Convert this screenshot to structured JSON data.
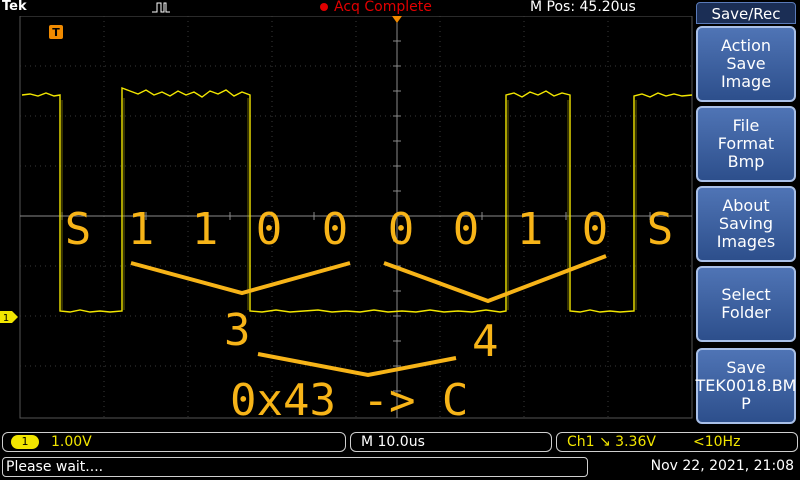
{
  "topbar": {
    "brand": "Tek",
    "acq_status": "Acq Complete",
    "mpos": "M Pos: 45.20us"
  },
  "menu": {
    "title": "Save/Rec",
    "buttons": [
      {
        "label": "Action\nSave Image"
      },
      {
        "label": "File\nFormat\nBmp"
      },
      {
        "label": "About\nSaving\nImages"
      },
      {
        "label": "Select\nFolder"
      },
      {
        "label": "Save\nTEK0018.BM\nP"
      }
    ]
  },
  "channel": {
    "badge": "1",
    "scale": "1.00V",
    "marker": "1",
    "color": "#f2e600"
  },
  "timebase": {
    "scale": "M 10.0us"
  },
  "trigger": {
    "source_level": "Ch1 ↘ 3.36V",
    "freq": "<10Hz",
    "marker": "T"
  },
  "status": {
    "message": "Please wait....",
    "datetime": "Nov 22, 2021, 21:08"
  },
  "annotation": {
    "color": "#f7b418",
    "bits": [
      "S",
      "1",
      "1",
      "0",
      "0",
      "0",
      "0",
      "1",
      "0",
      "S"
    ],
    "nibble_low": "3",
    "nibble_high": "4",
    "result": "0x43 -> C"
  }
}
